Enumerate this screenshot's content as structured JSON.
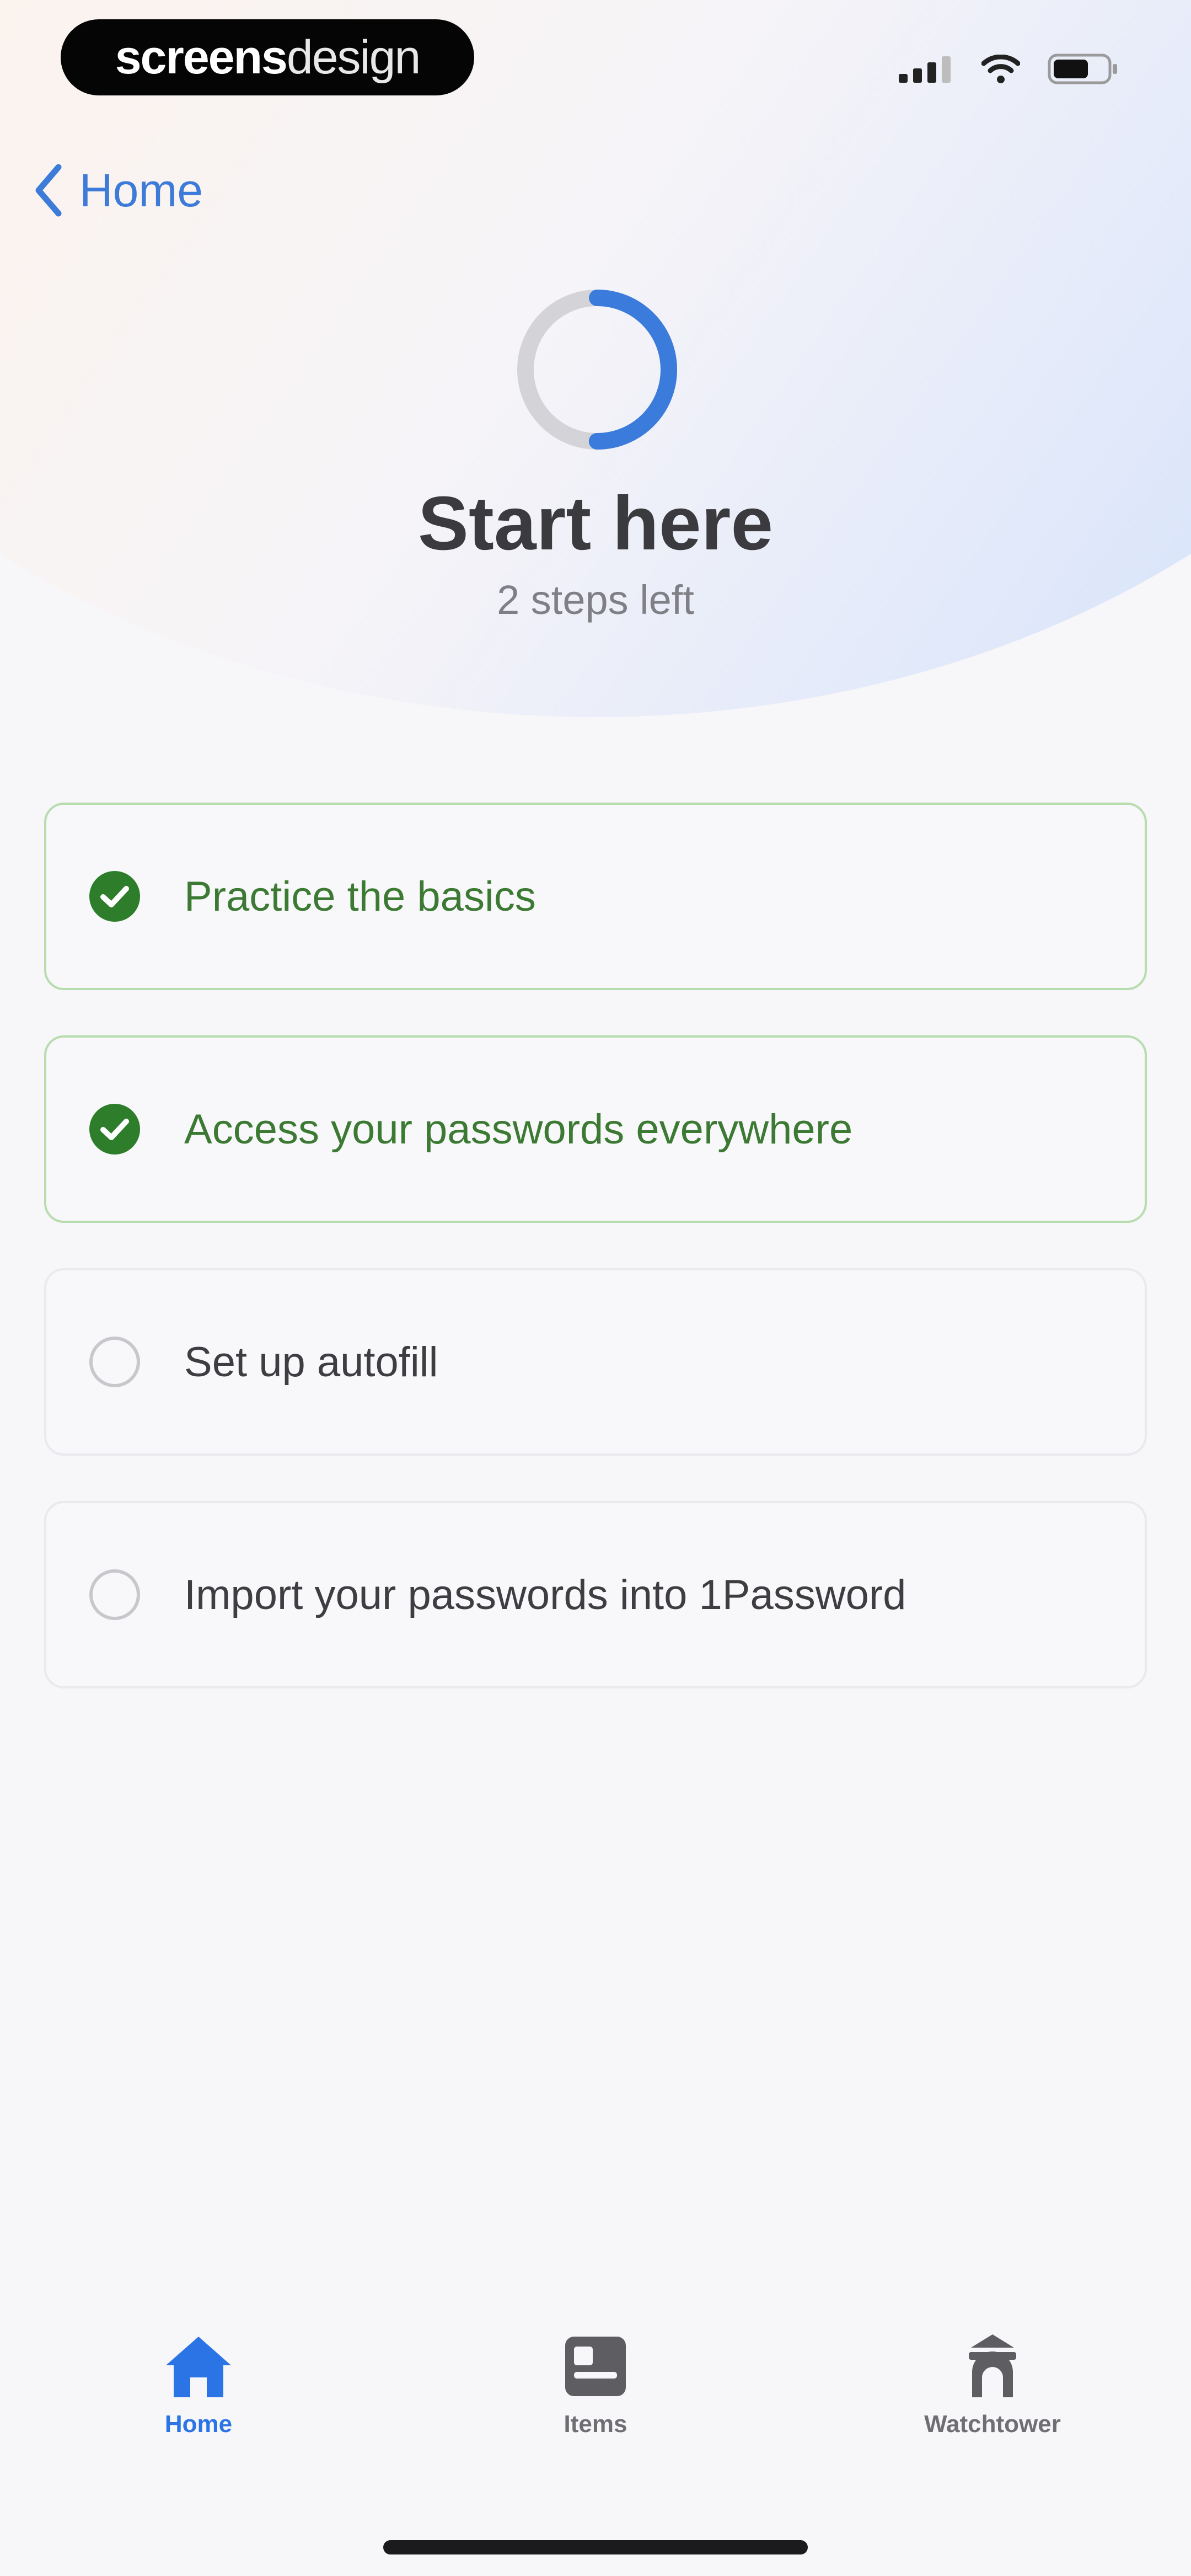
{
  "status_bar": {
    "brand_part1": "screens",
    "brand_part2": "design",
    "icons": [
      "signal-icon",
      "wifi-icon",
      "battery-icon"
    ]
  },
  "nav": {
    "back_label": "Home",
    "back_icon": "chevron-left-icon"
  },
  "progress": {
    "completed_fraction": 0.5,
    "accent_color": "#3a7bdc",
    "track_color": "#d4d4d8"
  },
  "header": {
    "title": "Start here",
    "subtitle": "2 steps left"
  },
  "checklist": [
    {
      "label": "Practice the basics",
      "done": true
    },
    {
      "label": "Access your passwords everywhere",
      "done": true
    },
    {
      "label": "Set up autofill",
      "done": false
    },
    {
      "label": "Import your passwords into 1Password",
      "done": false
    }
  ],
  "tabs": [
    {
      "label": "Home",
      "icon": "home-icon",
      "active": true
    },
    {
      "label": "Items",
      "icon": "items-icon",
      "active": false
    },
    {
      "label": "Watchtower",
      "icon": "watchtower-icon",
      "active": false
    }
  ],
  "colors": {
    "accent": "#2a74e6",
    "success": "#2e7d2b",
    "success_border": "#b7dcae"
  }
}
